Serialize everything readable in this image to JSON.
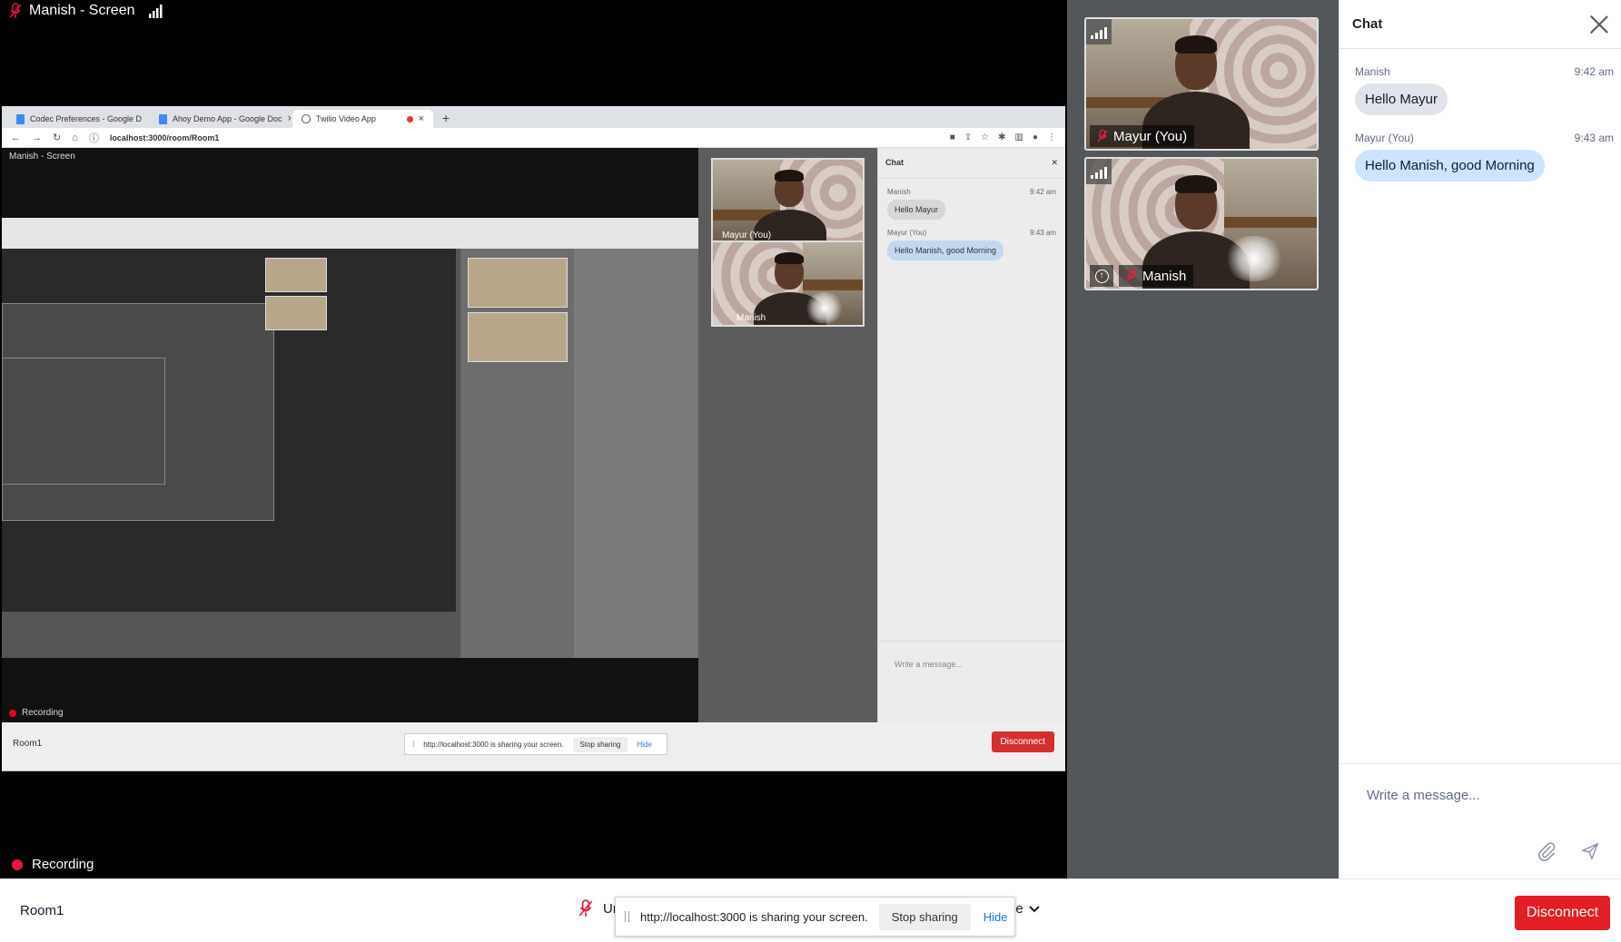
{
  "stage": {
    "screen_label": "Manish - Screen",
    "recording_label": "Recording"
  },
  "shared_window": {
    "tabs": [
      {
        "label": "Codec Preferences - Google D"
      },
      {
        "label": "Ahoy Demo App - Google Doc"
      },
      {
        "label": "Twilio Video App"
      }
    ],
    "new_tab": "+",
    "url": "localhost:3000/room/Room1",
    "inner_screen_label": "Manish - Screen",
    "inner_recording_label": "Recording",
    "inner_tiles": [
      {
        "label": "Mayur (You)"
      },
      {
        "label": "Manish"
      }
    ],
    "inner_chat": {
      "title": "Chat",
      "messages": [
        {
          "author": "Manish",
          "time": "9:42 am",
          "text": "Hello Mayur"
        },
        {
          "author": "Mayur (You)",
          "time": "9:43 am",
          "text": "Hello Manish, good Morning"
        }
      ],
      "placeholder": "Write a message..."
    },
    "inner_bottom": {
      "room": "Room1",
      "share_text": "http://localhost:3000 is sharing your screen.",
      "stop": "Stop sharing",
      "hide": "Hide",
      "disconnect": "Disconnect"
    }
  },
  "participants": [
    {
      "name": "Mayur (You)"
    },
    {
      "name": "Manish"
    }
  ],
  "chat": {
    "title": "Chat",
    "messages": [
      {
        "author": "Manish",
        "time": "9:42 am",
        "text": "Hello Mayur"
      },
      {
        "author": "Mayur (You)",
        "time": "9:43 am",
        "text": "Hello Manish, good Morning"
      }
    ],
    "input_placeholder": "Write a message..."
  },
  "bottom_bar": {
    "room_name": "Room1",
    "mute_label": "Ur",
    "more_label": "ore",
    "share_notice": "http://localhost:3000 is sharing your screen.",
    "stop_sharing": "Stop sharing",
    "hide": "Hide",
    "disconnect": "Disconnect"
  },
  "colors": {
    "disconnect": "#e31e26",
    "bubble_grey": "#e1e3ea",
    "bubble_blue": "#cce4ff",
    "recording_dot": "#e8193c"
  }
}
